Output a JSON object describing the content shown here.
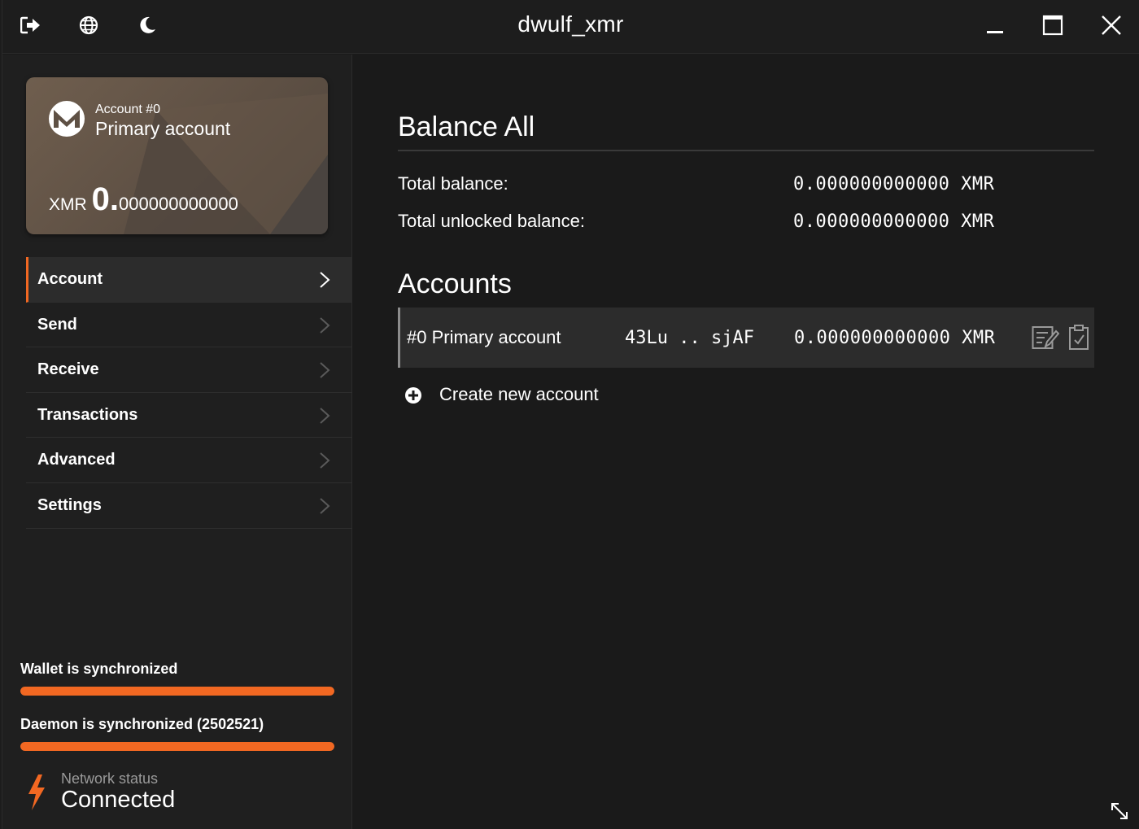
{
  "window": {
    "title": "dwulf_xmr"
  },
  "titlebar": {
    "icons": [
      "logout-icon",
      "globe-icon",
      "moon-icon"
    ],
    "controls": [
      "minimize-icon",
      "maximize-icon",
      "close-icon"
    ]
  },
  "card": {
    "account_number": "Account #0",
    "account_name": "Primary account",
    "currency": "XMR",
    "balance_int": "0",
    "balance_dot": ".",
    "balance_dec": "000000000000"
  },
  "menu": {
    "items": [
      {
        "label": "Account",
        "active": true
      },
      {
        "label": "Send"
      },
      {
        "label": "Receive"
      },
      {
        "label": "Transactions"
      },
      {
        "label": "Advanced"
      },
      {
        "label": "Settings"
      }
    ]
  },
  "status": {
    "wallet_sync": "Wallet is synchronized",
    "wallet_progress": 100,
    "daemon_sync": "Daemon is synchronized (2502521)",
    "daemon_progress": 100,
    "network_label": "Network status",
    "network_value": "Connected"
  },
  "main": {
    "balance_heading": "Balance All",
    "total_balance_label": "Total balance:",
    "total_balance_value": "0.000000000000 XMR",
    "unlocked_label": "Total unlocked balance:",
    "unlocked_value": "0.000000000000 XMR",
    "accounts_heading": "Accounts",
    "accounts": [
      {
        "name": "#0 Primary account",
        "address": "43Lu .. sjAF",
        "balance": "0.000000000000 XMR"
      }
    ],
    "create_account": "Create new account"
  },
  "colors": {
    "accent": "#f26822",
    "background": "#1a1a1a",
    "panel": "#2c2c2c"
  }
}
